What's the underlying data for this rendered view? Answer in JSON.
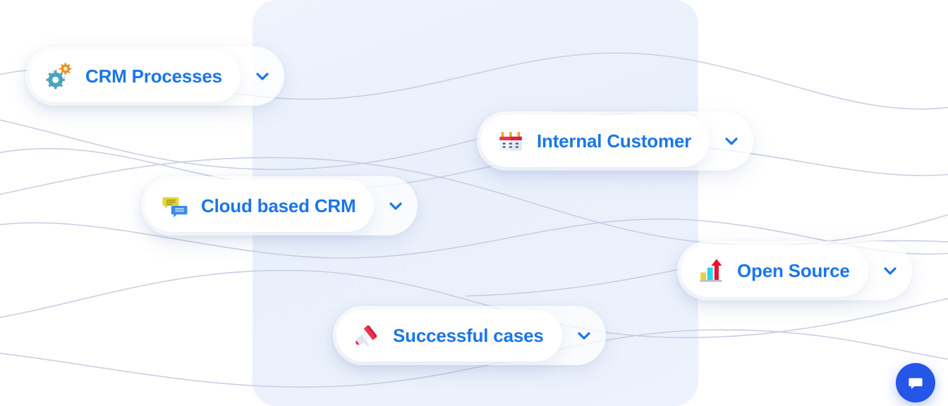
{
  "page": {
    "background_color": "#ffffff",
    "panel_color": "#eaf0fb",
    "accent_color": "#1a76ea",
    "wave_color": "#c7cde2"
  },
  "cards": [
    {
      "id": "crm-processes",
      "label": "CRM Processes",
      "icon": "gears-icon",
      "chevron": "chevron-down-icon"
    },
    {
      "id": "internal-customer",
      "label": "Internal Customer",
      "icon": "calendar-icon",
      "chevron": "chevron-down-icon"
    },
    {
      "id": "cloud-based-crm",
      "label": "Cloud based CRM",
      "icon": "chat-bubbles-icon",
      "chevron": "chevron-down-icon"
    },
    {
      "id": "open-source",
      "label": "Open Source",
      "icon": "bar-chart-arrow-icon",
      "chevron": "chevron-down-icon"
    },
    {
      "id": "successful-cases",
      "label": "Successful cases",
      "icon": "megaphone-icon",
      "chevron": "chevron-down-icon"
    }
  ],
  "chat_widget": {
    "icon": "chat-bubble-icon",
    "color": "#2456e8"
  }
}
